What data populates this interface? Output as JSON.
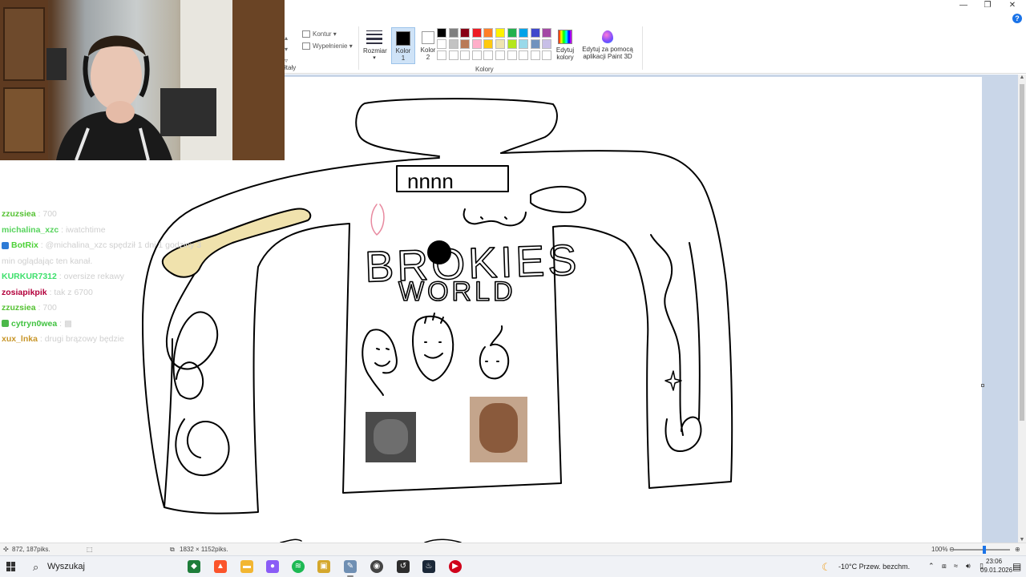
{
  "window": {
    "minimize_glyph": "—",
    "restore_glyph": "❐",
    "close_glyph": "✕",
    "help_glyph": "?"
  },
  "ribbon": {
    "shapes_group_label": "łtały",
    "outline_label": "Kontur",
    "fill_label": "Wypełnienie",
    "size_label": "Rozmiar",
    "color1_label_line1": "Kolor",
    "color1_label_line2": "1",
    "color2_label_line1": "Kolor",
    "color2_label_line2": "2",
    "colors_group_label": "Kolory",
    "edit_colors_line1": "Edytuj",
    "edit_colors_line2": "kolory",
    "paint3d_line1": "Edytuj za pomocą",
    "paint3d_line2": "aplikacji Paint 3D",
    "palette_row1": [
      "#000000",
      "#7f7f7f",
      "#880015",
      "#ed1c24",
      "#ff7f27",
      "#fff200",
      "#22b14c",
      "#00a2e8",
      "#3f48cc",
      "#a349a4"
    ],
    "palette_row2": [
      "#ffffff",
      "#c3c3c3",
      "#b97a57",
      "#ffaec9",
      "#ffc90e",
      "#efe4b0",
      "#b5e61d",
      "#99d9ea",
      "#7092be",
      "#c8bfe7"
    ],
    "palette_row3": [
      "#ffffff",
      "#ffffff",
      "#ffffff",
      "#ffffff",
      "#ffffff",
      "#ffffff",
      "#ffffff",
      "#ffffff",
      "#ffffff",
      "#ffffff"
    ]
  },
  "drawing": {
    "tag_text": "nnnn",
    "brand_line1": "BROKIES",
    "brand_line2": "WORLD"
  },
  "chat": [
    {
      "user": "zzuzsiea",
      "user_color": "#55c233",
      "badge": "",
      "msg": "700"
    },
    {
      "user": "michalina_xzc",
      "user_color": "#56d35c",
      "badge": "",
      "msg": "iwatchtime"
    },
    {
      "user": "BotRix",
      "user_color": "#4cd137",
      "badge": "bot",
      "msg": "@michalina_xzc spędził 1 dni 1 godziny 3"
    },
    {
      "user": "",
      "user_color": "#cfcfcf",
      "badge": "",
      "msg": "min oglądając ten kanał."
    },
    {
      "user": "KURKUR7312",
      "user_color": "#3ee06c",
      "badge": "",
      "msg": "oversize rekawy"
    },
    {
      "user": "zosiapikpik",
      "user_color": "#b3003c",
      "badge": "",
      "msg": "tak z 6700"
    },
    {
      "user": "zzuzsiea",
      "user_color": "#55c233",
      "badge": "",
      "msg": "700"
    },
    {
      "user": "cytryn0wea",
      "user_color": "#40c240",
      "badge": "gem",
      "msg": "▩"
    },
    {
      "user": "xux_lnka",
      "user_color": "#c8962a",
      "badge": "",
      "msg": "drugi brązowy będzie"
    }
  ],
  "statusbar": {
    "cursor_pos": "872, 187piks.",
    "image_size": "1832 × 1152piks.",
    "zoom": "100%",
    "zoom_level": 0.55
  },
  "taskbar": {
    "search_placeholder": "Wyszukaj",
    "weather": "-10°C  Przew. bezchm.",
    "time": "23:06",
    "date": "09.01.2026"
  }
}
